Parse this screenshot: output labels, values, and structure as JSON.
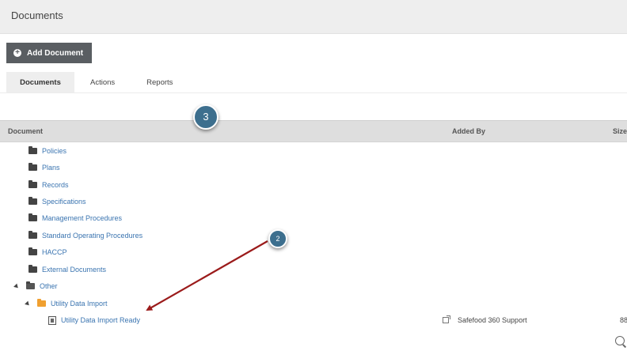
{
  "header": {
    "title": "Documents"
  },
  "toolbar": {
    "add_document_label": "Add Document"
  },
  "tabs": [
    {
      "label": "Documents",
      "active": true
    },
    {
      "label": "Actions",
      "active": false
    },
    {
      "label": "Reports",
      "active": false
    }
  ],
  "table": {
    "columns": [
      "Document",
      "Added By",
      "Size"
    ],
    "rows": [
      {
        "name": "Policies",
        "type": "folder"
      },
      {
        "name": "Plans",
        "type": "folder"
      },
      {
        "name": "Records",
        "type": "folder"
      },
      {
        "name": "Specifications",
        "type": "folder"
      },
      {
        "name": "Management Procedures",
        "type": "folder"
      },
      {
        "name": "Standard Operating Procedures",
        "type": "folder"
      },
      {
        "name": "HACCP",
        "type": "folder"
      },
      {
        "name": "External Documents",
        "type": "folder"
      },
      {
        "name": "Other",
        "type": "folder-open",
        "expanded": true
      },
      {
        "name": "Utility Data Import",
        "type": "folder-orange",
        "expanded": true
      },
      {
        "name": "Utility Data Import Ready",
        "type": "file",
        "added_by": "Safefood 360 Support",
        "size": "88"
      }
    ]
  },
  "annotations": {
    "badge_3": "3",
    "badge_2": "2"
  },
  "colors": {
    "link": "#3a74b0",
    "button_bg": "#5a5e62",
    "badge": "#3d6f8e",
    "arrow": "#9b1b1b"
  }
}
